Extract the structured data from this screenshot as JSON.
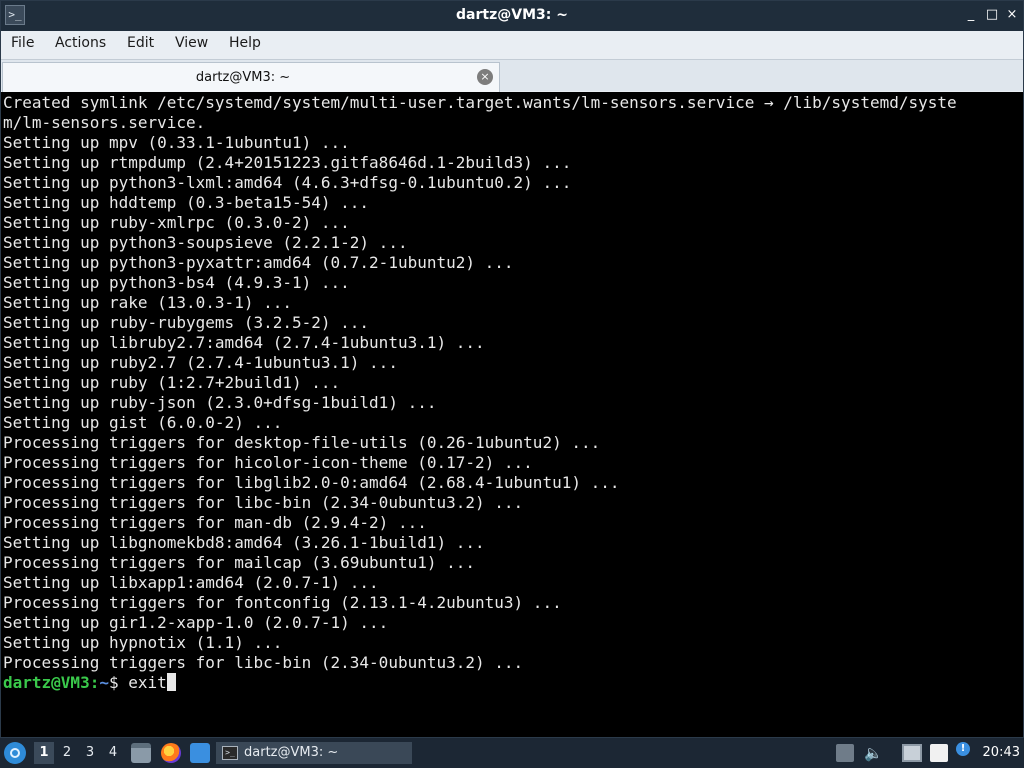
{
  "window": {
    "title": "dartz@VM3: ~",
    "app_icon_glyph": ">_",
    "controls": [
      "_",
      "□",
      "×"
    ]
  },
  "menubar": {
    "items": [
      "File",
      "Actions",
      "Edit",
      "View",
      "Help"
    ]
  },
  "tabs": [
    {
      "label": "dartz@VM3: ~",
      "close_glyph": "×"
    }
  ],
  "terminal": {
    "lines": [
      "Created symlink /etc/systemd/system/multi-user.target.wants/lm-sensors.service → /lib/systemd/syste",
      "m/lm-sensors.service.",
      "Setting up mpv (0.33.1-1ubuntu1) ...",
      "Setting up rtmpdump (2.4+20151223.gitfa8646d.1-2build3) ...",
      "Setting up python3-lxml:amd64 (4.6.3+dfsg-0.1ubuntu0.2) ...",
      "Setting up hddtemp (0.3-beta15-54) ...",
      "Setting up ruby-xmlrpc (0.3.0-2) ...",
      "Setting up python3-soupsieve (2.2.1-2) ...",
      "Setting up python3-pyxattr:amd64 (0.7.2-1ubuntu2) ...",
      "Setting up python3-bs4 (4.9.3-1) ...",
      "Setting up rake (13.0.3-1) ...",
      "Setting up ruby-rubygems (3.2.5-2) ...",
      "Setting up libruby2.7:amd64 (2.7.4-1ubuntu3.1) ...",
      "Setting up ruby2.7 (2.7.4-1ubuntu3.1) ...",
      "Setting up ruby (1:2.7+2build1) ...",
      "Setting up ruby-json (2.3.0+dfsg-1build1) ...",
      "Setting up gist (6.0.0-2) ...",
      "Processing triggers for desktop-file-utils (0.26-1ubuntu2) ...",
      "Processing triggers for hicolor-icon-theme (0.17-2) ...",
      "Processing triggers for libglib2.0-0:amd64 (2.68.4-1ubuntu1) ...",
      "Processing triggers for libc-bin (2.34-0ubuntu3.2) ...",
      "Processing triggers for man-db (2.9.4-2) ...",
      "Setting up libgnomekbd8:amd64 (3.26.1-1build1) ...",
      "Processing triggers for mailcap (3.69ubuntu1) ...",
      "Setting up libxapp1:amd64 (2.0.7-1) ...",
      "Processing triggers for fontconfig (2.13.1-4.2ubuntu3) ...",
      "Setting up gir1.2-xapp-1.0 (2.0.7-1) ...",
      "Setting up hypnotix (1.1) ...",
      "Processing triggers for libc-bin (2.34-0ubuntu3.2) ..."
    ],
    "prompt": {
      "user_host": "dartz@VM3",
      "separator": ":",
      "path": "~",
      "symbol": "$ ",
      "command": "exit"
    }
  },
  "taskbar": {
    "workspaces": [
      "1",
      "2",
      "3",
      "4"
    ],
    "active_workspace": "1",
    "launchers": [
      "file-manager-icon",
      "firefox-icon",
      "desktop-icon"
    ],
    "task": {
      "label": "dartz@VM3: ~",
      "icon_glyph": ">_"
    },
    "tray": [
      "clipboard-icon",
      "volume-icon",
      "network-icon",
      "notes-icon",
      "update-notification-icon"
    ],
    "clock": "20:43"
  },
  "colors": {
    "prompt_user": "#3ac94b",
    "prompt_path": "#5a8fe0",
    "terminal_bg": "#000000",
    "terminal_fg": "#e8e8e8",
    "titlebar_bg": "#1f2d3b"
  }
}
